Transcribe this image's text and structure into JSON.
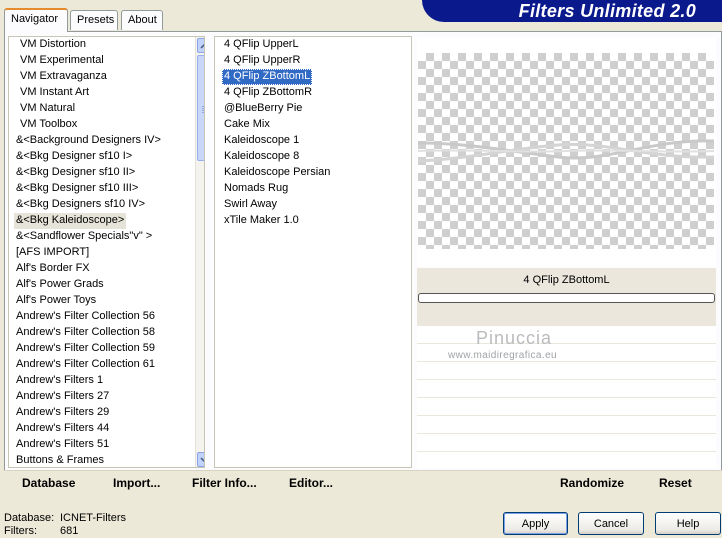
{
  "app": {
    "title": "Filters Unlimited 2.0"
  },
  "tabs": [
    {
      "label": "Navigator",
      "active": true
    },
    {
      "label": "Presets",
      "active": false
    },
    {
      "label": "About",
      "active": false
    }
  ],
  "categories": {
    "selected_index": 11,
    "items": [
      "VM Distortion",
      "VM Experimental",
      "VM Extravaganza",
      "VM Instant Art",
      "VM Natural",
      "VM Toolbox",
      "&<Background Designers IV>",
      "&<Bkg Designer sf10 I>",
      "&<Bkg Designer sf10 II>",
      "&<Bkg Designer sf10 III>",
      "&<Bkg Designers sf10 IV>",
      "&<Bkg Kaleidoscope>",
      "&<Sandflower Specials\"v\" >",
      "[AFS IMPORT]",
      "Alf's Border FX",
      "Alf's Power Grads",
      "Alf's Power Toys",
      "Andrew's Filter Collection 56",
      "Andrew's Filter Collection 58",
      "Andrew's Filter Collection 59",
      "Andrew's Filter Collection 61",
      "Andrew's Filters 1",
      "Andrew's Filters 27",
      "Andrew's Filters 29",
      "Andrew's Filters 44",
      "Andrew's Filters 51",
      "Buttons & Frames"
    ]
  },
  "filters": {
    "selected_index": 2,
    "items": [
      "4 QFlip UpperL",
      "4 QFlip UpperR",
      "4 QFlip ZBottomL",
      "4 QFlip ZBottomR",
      "@BlueBerry Pie",
      "Cake Mix",
      "Kaleidoscope 1",
      "Kaleidoscope 8",
      "Kaleidoscope Persian",
      "Nomads Rug",
      "Swirl Away",
      "xTile Maker 1.0"
    ]
  },
  "preview": {
    "filter_name": "4 QFlip ZBottomL",
    "watermark_name": "Pinuccia",
    "watermark_url": "www.maidiregrafica.eu"
  },
  "commands": {
    "database": "Database",
    "import": "Import...",
    "filter_info": "Filter Info...",
    "editor": "Editor...",
    "randomize": "Randomize",
    "reset": "Reset"
  },
  "status": {
    "database_label": "Database:",
    "database_value": "ICNET-Filters",
    "filters_label": "Filters:",
    "filters_value": "681"
  },
  "buttons": {
    "apply": "Apply",
    "cancel": "Cancel",
    "help": "Help"
  },
  "colors": {
    "banner": "#0a1a8c",
    "selection": "#316ac5",
    "face": "#ece9d8"
  }
}
